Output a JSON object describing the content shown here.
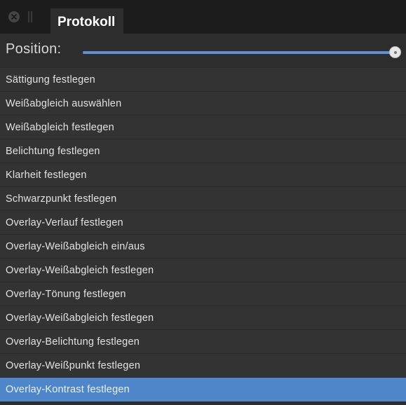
{
  "panel": {
    "tab_title": "Protokoll",
    "position_label": "Position:",
    "position_value": 1.0
  },
  "history": {
    "selected_index": 13,
    "items": [
      "Sättigung festlegen",
      "Weißabgleich auswählen",
      "Weißabgleich festlegen",
      "Belichtung festlegen",
      "Klarheit festlegen",
      "Schwarzpunkt festlegen",
      "Overlay-Verlauf festlegen",
      "Overlay-Weißabgleich ein/aus",
      "Overlay-Weißabgleich festlegen",
      "Overlay-Tönung festlegen",
      "Overlay-Weißabgleich festlegen",
      "Overlay-Belichtung festlegen",
      "Overlay-Weißpunkt festlegen",
      "Overlay-Kontrast festlegen"
    ]
  },
  "colors": {
    "accent": "#4f86c9",
    "slider_fill": "#5f8fd6",
    "background": "#2d2d2d"
  }
}
